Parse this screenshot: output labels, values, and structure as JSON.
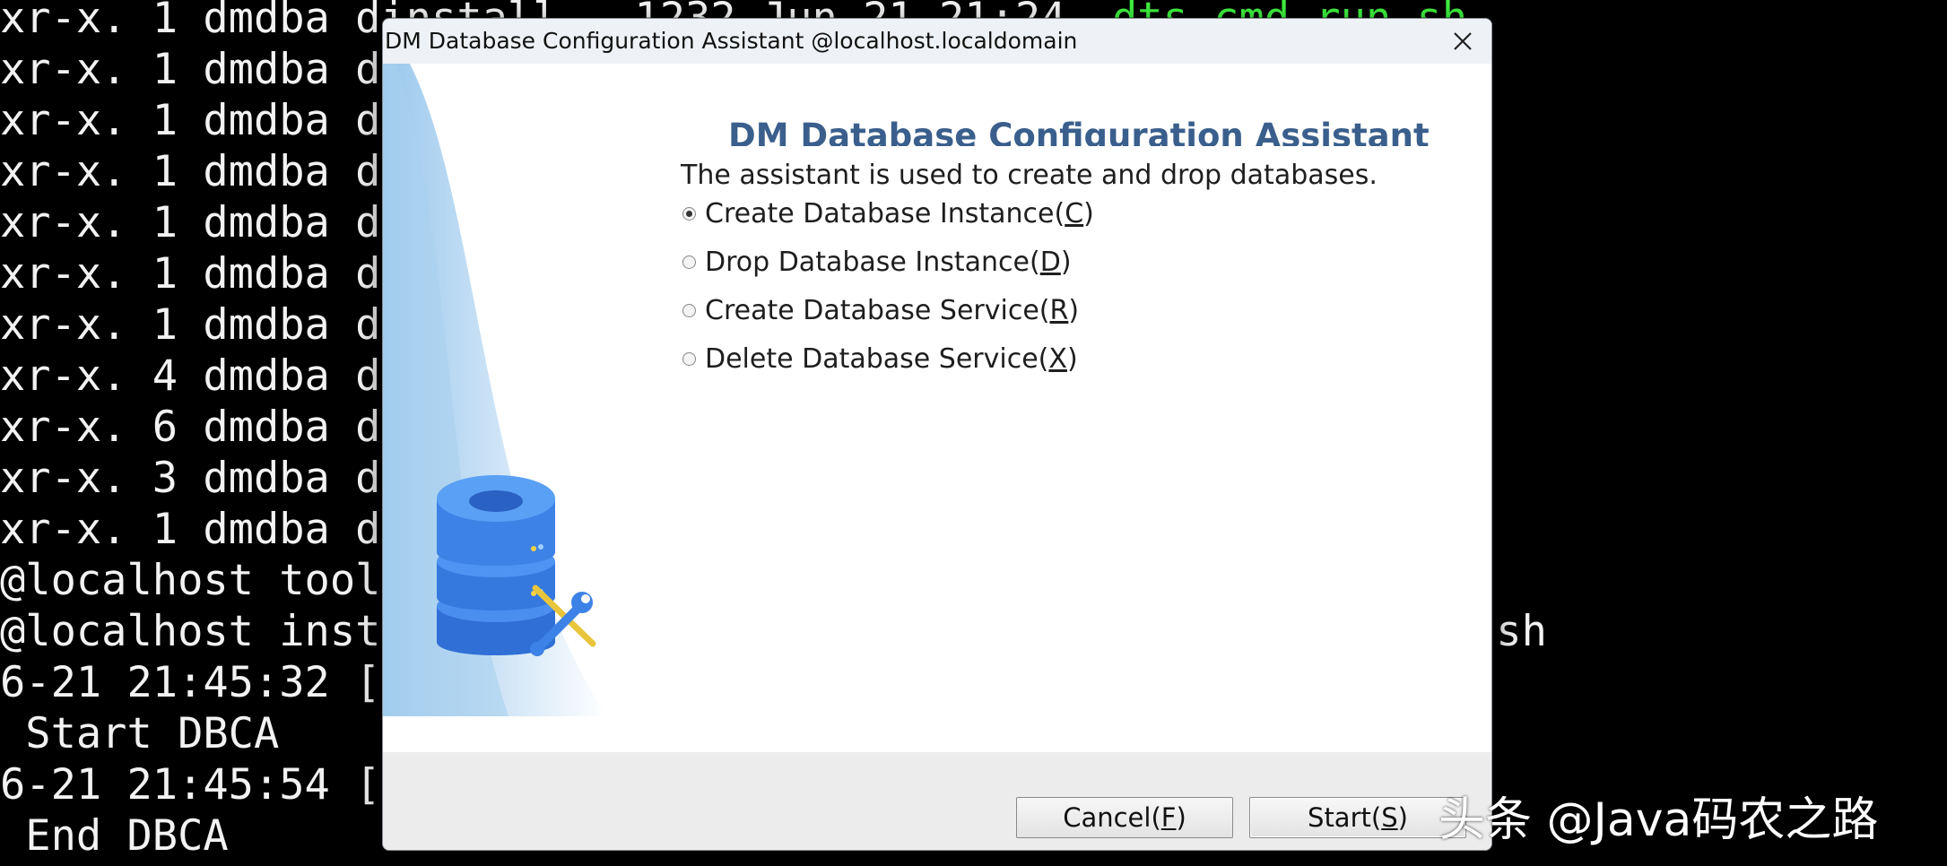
{
  "terminal": {
    "lines": [
      "xr-x. 1 dmdba dinstall   1232 Jun 21 21:24 ",
      "xr-x. 1 dmdba d",
      "xr-x. 1 dmdba d",
      "xr-x. 1 dmdba d",
      "xr-x. 1 dmdba d",
      "xr-x. 1 dmdba d",
      "xr-x. 1 dmdba d",
      "xr-x. 4 dmdba d",
      "xr-x. 6 dmdba d",
      "xr-x. 3 dmdba d",
      "xr-x. 1 dmdba d",
      "@localhost tool",
      "@localhost inst",
      "6-21 21:45:32 [",
      " Start DBCA",
      "6-21 21:45:54 [",
      " End DBCA"
    ],
    "green_fragment": "dts_cmd_run.sh",
    "right_fragment": ".sh"
  },
  "dialog": {
    "title": "DM Database Configuration Assistant @localhost.localdomain",
    "heading": "DM Database Configuration Assistant",
    "description": "The assistant is used to create and drop databases.",
    "options": [
      {
        "pre": "Create Database Instance(",
        "key": "C",
        "post": ")",
        "checked": true
      },
      {
        "pre": "Drop Database Instance(",
        "key": "D",
        "post": ")",
        "checked": false
      },
      {
        "pre": "Create Database Service(",
        "key": "R",
        "post": ")",
        "checked": false
      },
      {
        "pre": "Delete Database Service(",
        "key": "X",
        "post": ")",
        "checked": false
      }
    ],
    "buttons": {
      "cancel": {
        "pre": "Cancel(",
        "key": "F",
        "post": ")"
      },
      "start": {
        "pre": "Start(",
        "key": "S",
        "post": ")"
      }
    }
  },
  "watermark": "头条 @Java码农之路",
  "colors": {
    "heading": "#3a5f8c",
    "terminal_green": "#3ef03e",
    "database_blue": "#3f82e6"
  }
}
